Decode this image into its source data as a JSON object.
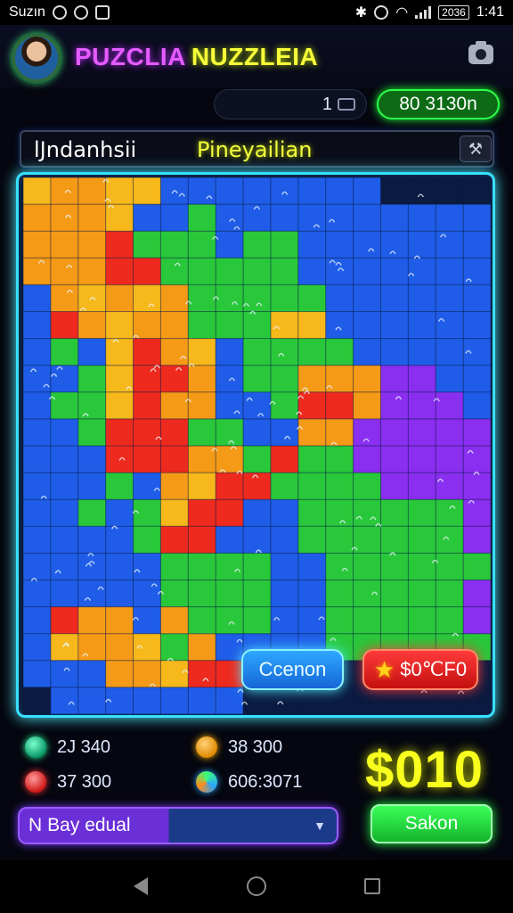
{
  "status": {
    "carrier": "Suzın",
    "battery": "2036",
    "time": "1:41"
  },
  "header": {
    "title_part1": "PUZCLIA",
    "title_part2": "NUZZLEIA"
  },
  "counters": {
    "moves": "1",
    "money": "80 3130n"
  },
  "level": {
    "left_label": "lJndanhsii",
    "right_label": "Pineyailian"
  },
  "board": {
    "cancel_label": "Ccenon",
    "score_label": "$0℃F0"
  },
  "stats": {
    "stat1": "2J 340",
    "stat2": "38 300",
    "stat3": "37 300",
    "stat4": "606:3071"
  },
  "total": "$010",
  "footer": {
    "select_value": "Bay edual",
    "select_prefix": "N",
    "save_label": "Sakon"
  },
  "icons": {
    "camera": "camera-icon",
    "hammer": "hammer-icon",
    "star": "star-icon",
    "chevron": "chevron-down-icon",
    "nav_back": "back-icon",
    "nav_home": "home-icon",
    "nav_recent": "recent-apps-icon"
  },
  "colors": {
    "board_border": "#38e0ff",
    "title_pink": "#e45cff",
    "title_yellow": "#f7ff3a",
    "money_green": "#2bff4a",
    "total_yellow": "#f8ff1e"
  }
}
